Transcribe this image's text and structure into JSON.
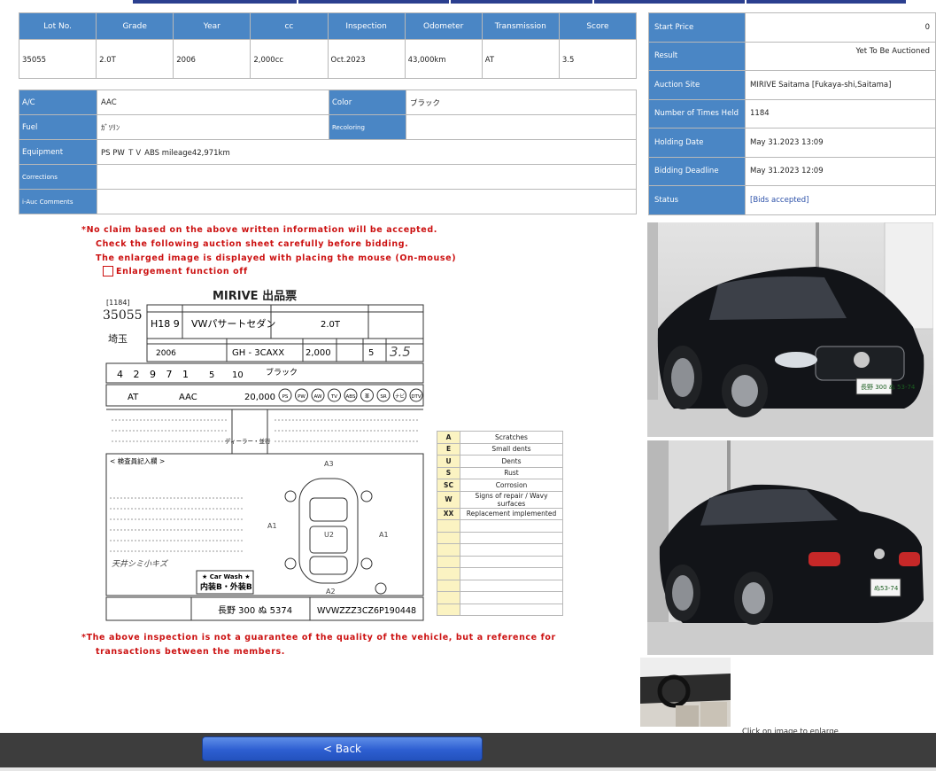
{
  "lot_table": {
    "headers": [
      "Lot No.",
      "Grade",
      "Year",
      "cc",
      "Inspection",
      "Odometer",
      "Transmission",
      "Score"
    ],
    "values": [
      "35055",
      "2.0T",
      "2006",
      "2,000cc",
      "Oct.2023",
      "43,000km",
      "AT",
      "3.5"
    ]
  },
  "spec": {
    "ac_label": "A/C",
    "ac_value": "AAC",
    "color_label": "Color",
    "color_value": "ブラック",
    "fuel_label": "Fuel",
    "fuel_value": "ｶﾞｿﾘﾝ",
    "recoloring_label": "Recoloring",
    "recoloring_value": "",
    "equipment_label": "Equipment",
    "equipment_value": "PS PW ＴＶ ABS mileage42,971km",
    "corrections_label": "Corrections",
    "corrections_value": "",
    "comments_label": "i-Auc Comments",
    "comments_value": ""
  },
  "info": {
    "start_price_label": "Start Price",
    "start_price_value": "0",
    "result_label": "Result",
    "result_value": "Yet To Be Auctioned",
    "site_label": "Auction Site",
    "site_value": "MIRIVE Saitama [Fukaya-shi,Saitama]",
    "times_label": "Number of Times Held",
    "times_value": "1184",
    "holding_label": "Holding Date",
    "holding_value": "May 31.2023 13:09",
    "deadline_label": "Bidding Deadline",
    "deadline_value": "May 31.2023 12:09",
    "status_label": "Status",
    "status_value": "[Bids accepted]"
  },
  "notices": {
    "line1": "*No claim based on the above written information will be accepted.",
    "line2": "Check the following auction sheet carefully before bidding.",
    "line3": "The enlarged image is displayed with placing the mouse (On-mouse)",
    "enlargement": "Enlargement function off",
    "bottom1": "*The above inspection is not a guarantee of the quality of the vehicle, but a reference for",
    "bottom2": "transactions between the members."
  },
  "sheet": {
    "header": "MIRIVE 出品票",
    "session": "[1184]",
    "lot": "35055",
    "region": "埼玉",
    "model_year": "H18 9",
    "model": "VWパサートセダン",
    "grade": "2.0T",
    "year": "2006",
    "chassis": "GH - 3CAXX",
    "cc": "2,000",
    "doors": "5",
    "score": "3.5",
    "mileage": "4 2 9 7 1",
    "seats": "5",
    "month": "10",
    "color": "ブラック",
    "shift": "AT",
    "aircon": "AAC",
    "price": "20,000",
    "equip": [
      "PS",
      "PW",
      "AW",
      "TV",
      "ABS",
      "革",
      "SR",
      "ナビ",
      "DTV"
    ],
    "dealer": "ディーラー・並行",
    "inspector_title": "< 検査員記入欄 >",
    "handwritten": "天井シミ小キズ",
    "carwash": "★ Car Wash ★",
    "carwash2": "内装B・外装B",
    "plate": "長野 300 ぬ 5374",
    "vin": "WVWZZZ3CZ6P190448"
  },
  "legend": [
    {
      "code": "A",
      "desc": "Scratches"
    },
    {
      "code": "E",
      "desc": "Small dents"
    },
    {
      "code": "U",
      "desc": "Dents"
    },
    {
      "code": "S",
      "desc": "Rust"
    },
    {
      "code": "SC",
      "desc": "Corrosion"
    },
    {
      "code": "W",
      "desc": "Signs of repair / Wavy surfaces"
    },
    {
      "code": "XX",
      "desc": "Replacement implemented"
    }
  ],
  "photos": {
    "plate1": "長野 300\nぬ 53-74",
    "plate2": "ぬ53-74"
  },
  "enlarge_note": "Click on image to enlarge",
  "back_label": "< Back"
}
